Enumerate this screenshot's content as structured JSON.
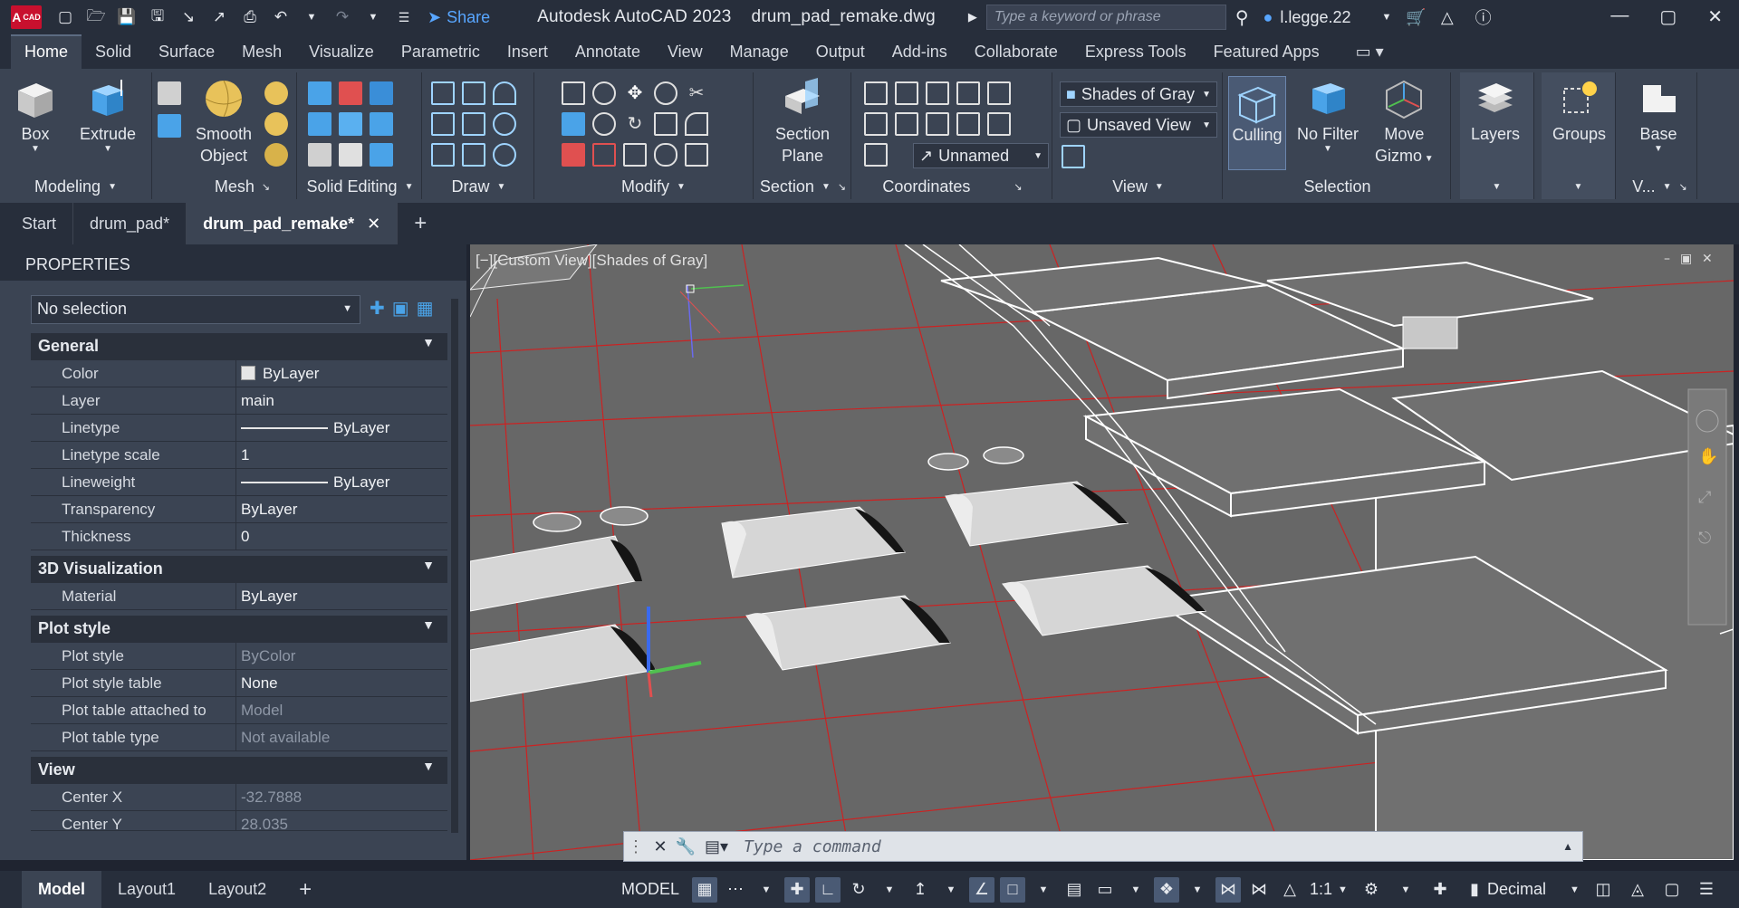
{
  "app": {
    "title": "Autodesk AutoCAD 2023",
    "filename": "drum_pad_remake.dwg",
    "logo_text": "A",
    "logo_sub": "CAD",
    "share_label": "Share",
    "search_placeholder": "Type a keyword or phrase",
    "username": "l.legge.22"
  },
  "menu_tabs": [
    "Home",
    "Solid",
    "Surface",
    "Mesh",
    "Visualize",
    "Parametric",
    "Insert",
    "Annotate",
    "View",
    "Manage",
    "Output",
    "Add-ins",
    "Collaborate",
    "Express Tools",
    "Featured Apps"
  ],
  "ribbon": {
    "box": "Box",
    "extrude": "Extrude",
    "smooth_object_1": "Smooth",
    "smooth_object_2": "Object",
    "section_plane_1": "Section",
    "section_plane_2": "Plane",
    "visual_style": "Shades of Gray",
    "view_name": "Unsaved View",
    "ucs_name": "Unnamed",
    "culling": "Culling",
    "no_filter": "No Filter",
    "move_gizmo_1": "Move",
    "move_gizmo_2": "Gizmo",
    "layers": "Layers",
    "groups": "Groups",
    "base": "Base",
    "panels": {
      "modeling": "Modeling",
      "mesh": "Mesh",
      "solid_editing": "Solid Editing",
      "draw": "Draw",
      "modify": "Modify",
      "section": "Section",
      "coordinates": "Coordinates",
      "view": "View",
      "selection": "Selection",
      "v_trunc": "V..."
    }
  },
  "file_tabs": [
    "Start",
    "drum_pad*",
    "drum_pad_remake*"
  ],
  "properties": {
    "title": "PROPERTIES",
    "selection": "No selection",
    "sections": {
      "general": "General",
      "viz": "3D Visualization",
      "plot": "Plot style",
      "view": "View"
    },
    "general": [
      {
        "k": "Color",
        "v": "ByLayer"
      },
      {
        "k": "Layer",
        "v": "main"
      },
      {
        "k": "Linetype",
        "v": "ByLayer"
      },
      {
        "k": "Linetype scale",
        "v": "1"
      },
      {
        "k": "Lineweight",
        "v": "ByLayer"
      },
      {
        "k": "Transparency",
        "v": "ByLayer"
      },
      {
        "k": "Thickness",
        "v": "0"
      }
    ],
    "viz": [
      {
        "k": "Material",
        "v": "ByLayer"
      }
    ],
    "plot": [
      {
        "k": "Plot style",
        "v": "ByColor"
      },
      {
        "k": "Plot style table",
        "v": "None"
      },
      {
        "k": "Plot table attached to",
        "v": "Model"
      },
      {
        "k": "Plot table type",
        "v": "Not available"
      }
    ],
    "view": [
      {
        "k": "Center X",
        "v": "-32.7888"
      },
      {
        "k": "Center Y",
        "v": "28.035"
      }
    ]
  },
  "viewport": {
    "label": "[−][Custom View][Shades of Gray]"
  },
  "command": {
    "placeholder": "Type a command"
  },
  "status": {
    "layout_tabs": [
      "Model",
      "Layout1",
      "Layout2"
    ],
    "model_label": "MODEL",
    "scale": "1:1",
    "units": "Decimal"
  },
  "colors": {
    "accent": "#58a6ff",
    "grid_red": "#d42020",
    "viewport_bg": "#676767"
  }
}
